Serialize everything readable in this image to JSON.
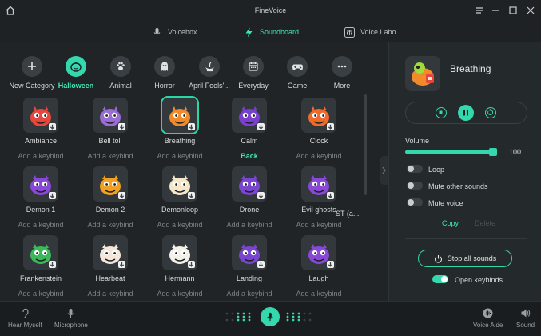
{
  "app": {
    "title": "FineVoice"
  },
  "tabs": [
    {
      "label": "Voicebox",
      "icon": "microphone-icon",
      "active": false
    },
    {
      "label": "Soundboard",
      "icon": "lightning-icon",
      "active": true
    },
    {
      "label": "Voice Labo",
      "icon": "sliders-icon",
      "active": false
    }
  ],
  "categories": [
    {
      "label": "New Category",
      "icon": "plus-icon",
      "active": false
    },
    {
      "label": "Halloween",
      "icon": "pumpkin-icon",
      "active": true
    },
    {
      "label": "Animal",
      "icon": "paw-icon",
      "active": false
    },
    {
      "label": "Horror",
      "icon": "ghost-icon",
      "active": false
    },
    {
      "label": "April Fools'...",
      "icon": "genie-lamp-icon",
      "active": false
    },
    {
      "label": "Everyday",
      "icon": "calendar-icon",
      "active": false
    },
    {
      "label": "Game",
      "icon": "gamepad-icon",
      "active": false
    },
    {
      "label": "More",
      "icon": "more-dots-icon",
      "active": false
    }
  ],
  "sounds": [
    {
      "name": "Ambiance",
      "keybind": "Add a keybind",
      "color": "#e8463c"
    },
    {
      "name": "Bell toll",
      "keybind": "Add a keybind",
      "color": "#9b6bd6"
    },
    {
      "name": "Breathing",
      "keybind": "Add a keybind",
      "color": "#f08a2a",
      "selected": true
    },
    {
      "name": "Calm",
      "keybind": "Back",
      "color": "#7a3fd0",
      "keybind_set": true
    },
    {
      "name": "Clock",
      "keybind": "Add a keybind",
      "color": "#f06a2a"
    },
    {
      "name": "Demon 1",
      "keybind": "Add a keybind",
      "color": "#8a48d8"
    },
    {
      "name": "Demon 2",
      "keybind": "Add a keybind",
      "color": "#f2a020"
    },
    {
      "name": "Demonloop",
      "keybind": "Add a keybind",
      "color": "#f4e6c8"
    },
    {
      "name": "Drone",
      "keybind": "Add a keybind",
      "color": "#7a45d0"
    },
    {
      "name": "Evil ghosts",
      "keybind": "Add a keybind",
      "color": "#8a48d8",
      "extra": "ST (a..."
    },
    {
      "name": "Frankenstein",
      "keybind": "Add a keybind",
      "color": "#3cb85a"
    },
    {
      "name": "Hearbeat",
      "keybind": "Add a keybind",
      "color": "#f4e6d8"
    },
    {
      "name": "Hermann",
      "keybind": "Add a keybind",
      "color": "#f4f0ea"
    },
    {
      "name": "Landing",
      "keybind": "Add a keybind",
      "color": "#7a45d0"
    },
    {
      "name": "Laugh",
      "keybind": "Add a keybind",
      "color": "#8a48d8"
    }
  ],
  "panel": {
    "now_playing": "Breathing",
    "volume_label": "Volume",
    "volume_value": "100",
    "volume_level": 1.0,
    "loop_label": "Loop",
    "mute_other_label": "Mute other sounds",
    "mute_voice_label": "Mute voice",
    "copy_label": "Copy",
    "delete_label": "Delete",
    "stop_all_label": "Stop all sounds",
    "open_keybinds_label": "Open keybinds"
  },
  "bottom": {
    "hear_myself": "Hear Myself",
    "microphone": "Microphone",
    "voice_aide": "Voice Aide",
    "sound": "Sound"
  },
  "colors": {
    "accent": "#35d7ad",
    "background": "#1c2023"
  }
}
